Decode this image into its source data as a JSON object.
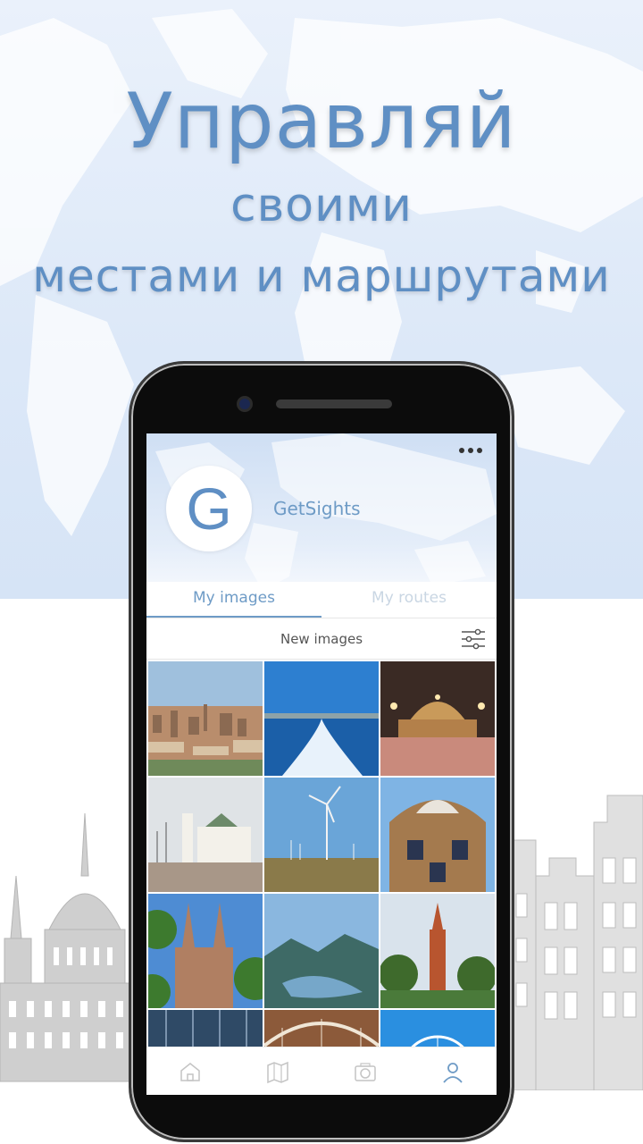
{
  "promo": {
    "line1": "Управляй",
    "line2": "своими",
    "line3": "местами и маршрутами"
  },
  "app": {
    "avatar_letter": "G",
    "name": "GetSights",
    "tabs": [
      {
        "label": "My images",
        "active": true
      },
      {
        "label": "My routes",
        "active": false
      }
    ],
    "filter_label": "New images",
    "icons": {
      "menu": "more-dots-icon",
      "filter": "filter-sliders-icon",
      "nav": [
        "home-icon",
        "map-icon",
        "camera-icon",
        "profile-icon"
      ]
    },
    "gallery": [
      "barcelona-city-view",
      "sea-wake",
      "fountain-night",
      "cathedral-square",
      "wind-turbines",
      "gaudi-house",
      "gothic-church",
      "mountain-lake",
      "tower-palms",
      "glass-building",
      "station-roof",
      "ferris-wheel"
    ]
  },
  "colors": {
    "accent": "#5f8fc4",
    "headline": "#5f8fc4",
    "inactive_tab": "#c9d6e3"
  }
}
